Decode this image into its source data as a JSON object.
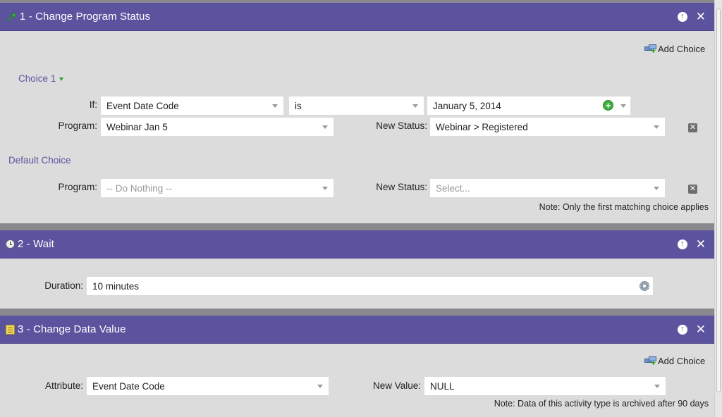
{
  "flow_steps": [
    {
      "title": "1 - Change Program Status",
      "icon": "green-arrow-icon",
      "add_choice_label": "Add Choice",
      "choice": {
        "label": "Choice 1",
        "if_label": "If:",
        "if_attribute": "Event Date Code",
        "operator": "is",
        "value": "January 5, 2014",
        "program_label": "Program:",
        "program": "Webinar Jan 5",
        "new_status_label": "New Status:",
        "new_status": "Webinar > Registered"
      },
      "default_choice": {
        "label": "Default Choice",
        "program_label": "Program:",
        "program": "-- Do Nothing --",
        "new_status_label": "New Status:",
        "new_status_placeholder": "Select..."
      },
      "note": "Note: Only the first matching choice applies"
    },
    {
      "title": "2 - Wait",
      "icon": "clock-icon",
      "duration_label": "Duration:",
      "duration": "10 minutes"
    },
    {
      "title": "3 - Change Data Value",
      "icon": "notepad-icon",
      "add_choice_label": "Add Choice",
      "attribute_label": "Attribute:",
      "attribute": "Event Date Code",
      "new_value_label": "New Value:",
      "new_value": "NULL",
      "note": "Note: Data of this activity type is archived after 90 days"
    }
  ],
  "controls": {
    "move_up_glyph": "↑",
    "close_glyph": "✕",
    "remove_glyph": "✕",
    "add_glyph": "+"
  },
  "colors": {
    "header": "#5c539f",
    "link": "#5c539f",
    "separator": "#8a8a8e",
    "body": "#dcdcdc"
  }
}
